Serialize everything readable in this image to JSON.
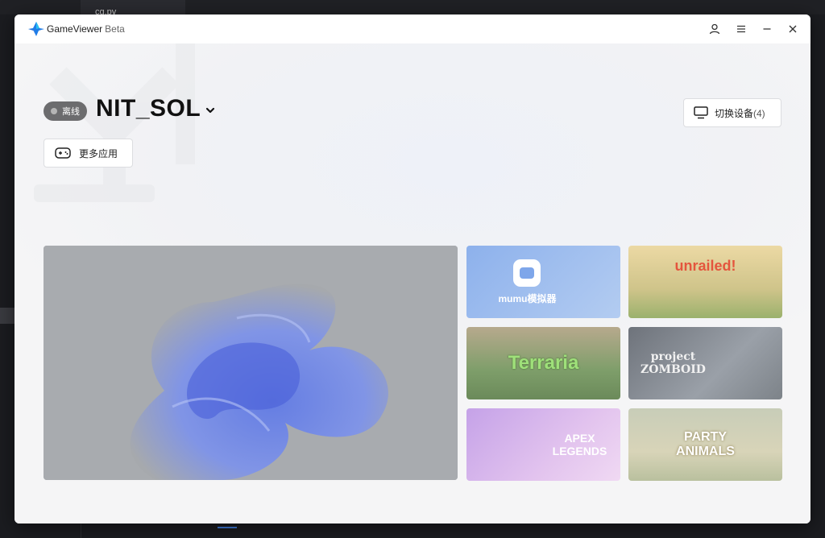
{
  "background": {
    "tab_label": "cg.py"
  },
  "titlebar": {
    "app_name": "GameViewer",
    "badge": "Beta",
    "icons": [
      "user-icon",
      "menu-icon",
      "minimize-icon",
      "close-icon"
    ]
  },
  "device": {
    "status": "离线",
    "name": "NIT_SOL"
  },
  "buttons": {
    "switch_label": "切换设备",
    "switch_count": "(4)",
    "more_apps": "更多应用"
  },
  "games": [
    {
      "title": "mumu模拟器",
      "bg": "#8fb4ec"
    },
    {
      "title": "unrailed!",
      "bg": "#e6ce92"
    },
    {
      "title": "Terraria",
      "bg": "#8fa87c"
    },
    {
      "title": "project ZOMBOID",
      "bg": "#8b8f97"
    },
    {
      "title": "APEX LEGENDS",
      "bg": "#d7b3e8"
    },
    {
      "title": "PARTY ANIMALS",
      "bg": "#c9cdb8"
    }
  ],
  "colors": {
    "accent": "#3d7bd9",
    "status_pill": "#6c6c6e"
  }
}
